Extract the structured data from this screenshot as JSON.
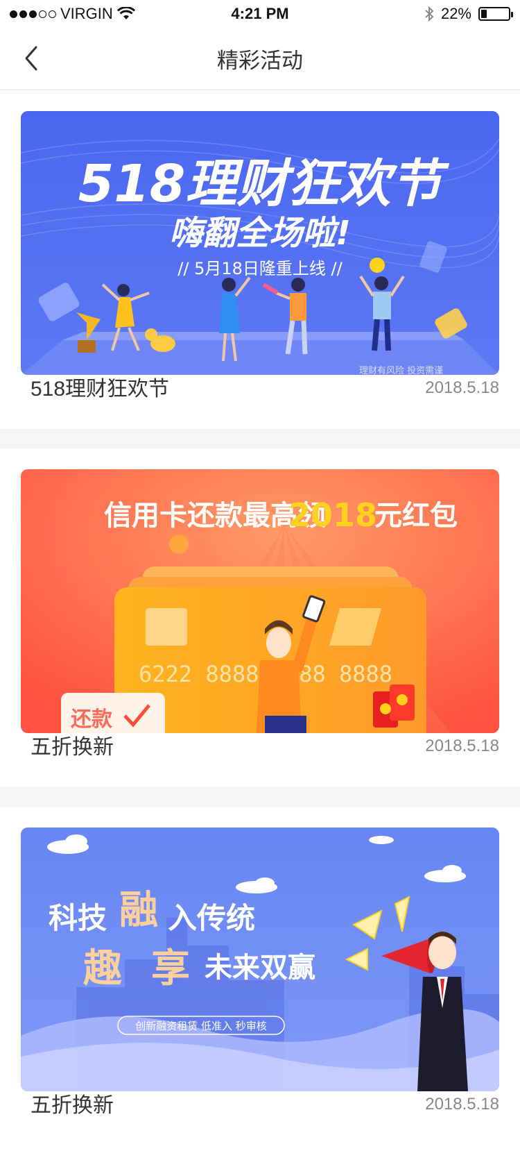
{
  "status_bar": {
    "carrier": "VIRGIN",
    "time": "4:21 PM",
    "battery": "22%",
    "battery_level": 0.22
  },
  "nav": {
    "title": "精彩活动"
  },
  "activities": [
    {
      "banner": {
        "headline": "518理财狂欢节",
        "subline": "嗨翻全场啦!",
        "tagline": "// 5月18日隆重上线 //",
        "footnote": "理财有风险 投资需谨"
      },
      "title": "518理财狂欢节",
      "date": "2018.5.18"
    },
    {
      "banner": {
        "headline_prefix": "信用卡还款最高领",
        "headline_amount": "2018",
        "headline_suffix": "元红包",
        "card_number": "6222 8888 8888 8888",
        "stamp": "还款"
      },
      "title": "五折换新",
      "date": "2018.5.18"
    },
    {
      "banner": {
        "line1_a": "科技",
        "line1_b": "融",
        "line1_c": "入传统",
        "line2_a": "趣",
        "line2_b": "享",
        "line2_c": "未来双赢",
        "tags": "创新融资租赁   低准入   秒审核"
      },
      "title": "五折换新",
      "date": "2018.5.18"
    }
  ],
  "colors": {
    "banner1_bg": "#4f6cf0",
    "banner2_bg": "#ff5a4a",
    "banner3_bg": "#6c88f3",
    "gold": "#ffd21e"
  }
}
